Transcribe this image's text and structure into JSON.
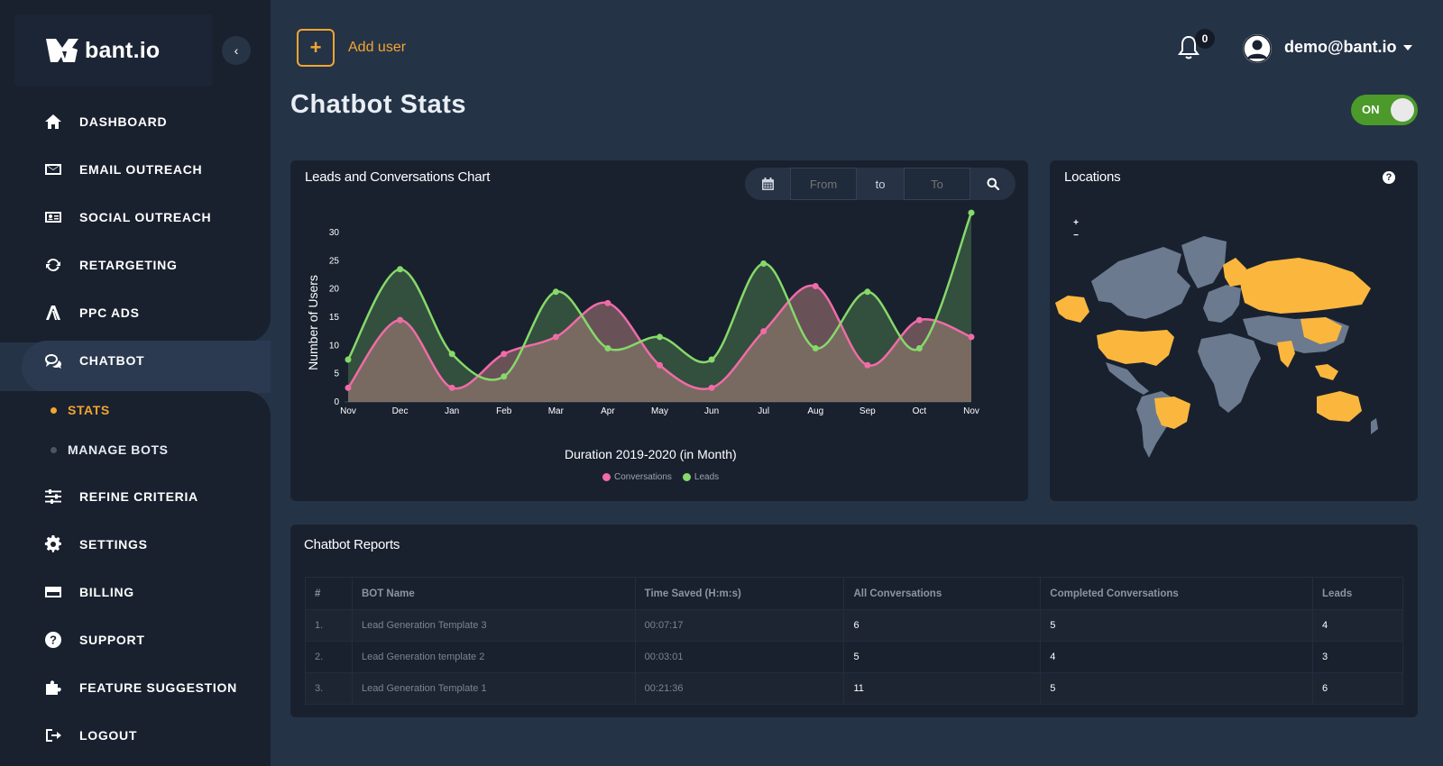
{
  "brand": {
    "name": "bant.io"
  },
  "sidebar": {
    "items": [
      {
        "label": "DASHBOARD",
        "icon": "home-icon"
      },
      {
        "label": "EMAIL OUTREACH",
        "icon": "envelope-icon"
      },
      {
        "label": "SOCIAL OUTREACH",
        "icon": "id-card-icon"
      },
      {
        "label": "RETARGETING",
        "icon": "refresh-icon"
      },
      {
        "label": "PPC ADS",
        "icon": "ads-icon"
      },
      {
        "label": "CHATBOT",
        "icon": "chat-icon"
      },
      {
        "label": "REFINE CRITERIA",
        "icon": "sliders-icon"
      },
      {
        "label": "SETTINGS",
        "icon": "gear-icon"
      },
      {
        "label": "BILLING",
        "icon": "credit-card-icon"
      },
      {
        "label": "SUPPORT",
        "icon": "question-circle-icon"
      },
      {
        "label": "FEATURE SUGGESTION",
        "icon": "puzzle-icon"
      },
      {
        "label": "LOGOUT",
        "icon": "logout-icon"
      }
    ],
    "active_item": "CHATBOT",
    "subitems": [
      {
        "label": "STATS",
        "active": true
      },
      {
        "label": "MANAGE BOTS",
        "active": false
      }
    ]
  },
  "header": {
    "add_user_label": "Add user",
    "add_icon": "+",
    "notification_count": "0",
    "user_email": "demo@bant.io"
  },
  "page": {
    "title": "Chatbot Stats",
    "toggle_label": "ON"
  },
  "chart_card": {
    "title": "Leads and Conversations Chart",
    "filter": {
      "from_placeholder": "From",
      "to_text": "to",
      "to_placeholder": "To"
    }
  },
  "chart_data": {
    "type": "area",
    "title": "",
    "xlabel": "Duration 2019-2020 (in Month)",
    "ylabel": "Number of Users",
    "categories": [
      "Nov",
      "Dec",
      "Jan",
      "Feb",
      "Mar",
      "Apr",
      "May",
      "Jun",
      "Jul",
      "Aug",
      "Sep",
      "Oct",
      "Nov"
    ],
    "yticks": [
      "0",
      "5",
      "10",
      "15",
      "20",
      "25",
      "30"
    ],
    "ylim": [
      0,
      30
    ],
    "legend_position": "bottom",
    "series": [
      {
        "name": "Conversations",
        "color": "#f06ba8",
        "values": [
          2.5,
          14.5,
          2.5,
          8.5,
          11.5,
          17.5,
          6.5,
          2.5,
          12.5,
          20.5,
          6.5,
          14.5,
          11.5
        ]
      },
      {
        "name": "Leads",
        "color": "#86d96a",
        "values": [
          7.5,
          23.5,
          8.5,
          4.5,
          19.5,
          9.5,
          11.5,
          7.5,
          24.5,
          9.5,
          19.5,
          9.5,
          33.5
        ]
      }
    ]
  },
  "locations_card": {
    "title": "Locations",
    "help_icon": "?",
    "zoom_in": "+",
    "zoom_out": "−",
    "highlight_color": "#fbb73d",
    "base_color": "#6b7a8f"
  },
  "reports": {
    "title": "Chatbot Reports",
    "columns": [
      "#",
      "BOT Name",
      "Time Saved (H:m:s)",
      "All Conversations",
      "Completed Conversations",
      "Leads"
    ],
    "rows": [
      [
        "1.",
        "Lead Generation Template 3",
        "00:07:17",
        "6",
        "5",
        "4"
      ],
      [
        "2.",
        "Lead Generation template 2",
        "00:03:01",
        "5",
        "4",
        "3"
      ],
      [
        "3.",
        "Lead Generation Template 1",
        "00:21:36",
        "11",
        "5",
        "6"
      ]
    ]
  },
  "colors": {
    "accent": "#f3a530",
    "background": "#253347",
    "panel": "#19212f",
    "toggle_on": "#4b9a2a"
  }
}
